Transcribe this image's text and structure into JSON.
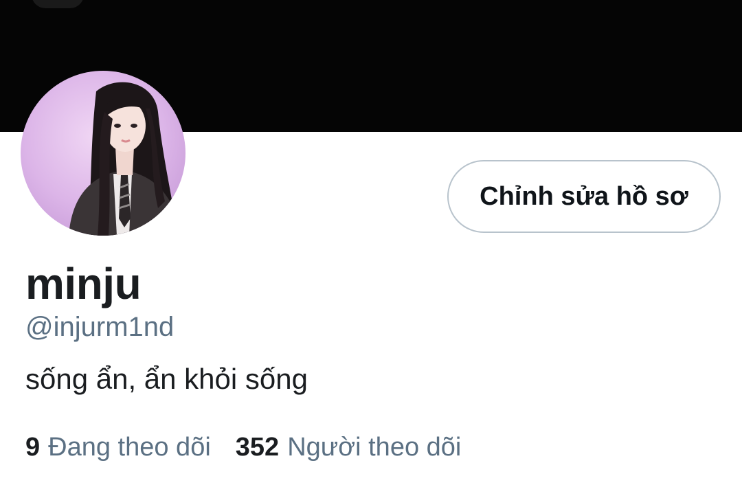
{
  "profile": {
    "display_name": "minju",
    "handle": "@injurm1nd",
    "bio": "sống ẩn, ẩn khỏi sống",
    "edit_button_label": "Chỉnh sửa hồ sơ"
  },
  "stats": {
    "following_count": "9",
    "following_label": "Đang theo dõi",
    "followers_count": "352",
    "followers_label": "Người theo dõi"
  },
  "colors": {
    "banner": "#050505",
    "text_primary": "#1a1d20",
    "text_secondary": "#5b7083",
    "button_border": "#b8c3cc",
    "avatar_background": "#e4c4ee"
  }
}
